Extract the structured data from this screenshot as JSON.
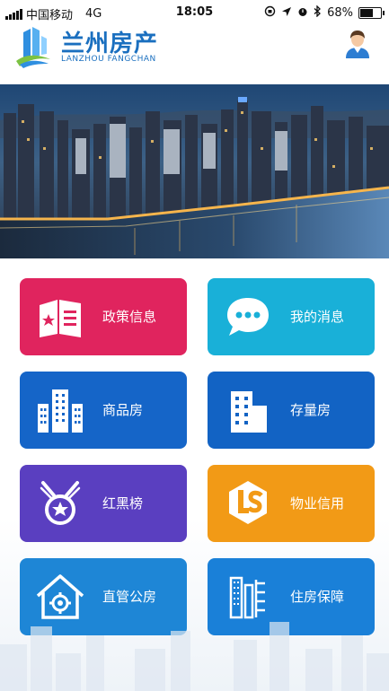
{
  "status_bar": {
    "carrier": "中国移动",
    "network": "4G",
    "time": "18:05",
    "battery": "68%",
    "battery_level": 0.68
  },
  "header": {
    "title": "兰州房产",
    "subtitle": "LANZHOU FANGCHAN",
    "avatar_icon": "user-avatar-icon"
  },
  "menu": [
    {
      "label": "政策信息",
      "color": "#e0245e",
      "icon": "policy-icon"
    },
    {
      "label": "我的消息",
      "color": "#19b0d8",
      "icon": "message-icon"
    },
    {
      "label": "商品房",
      "color": "#1565c8",
      "icon": "buildings-icon"
    },
    {
      "label": "存量房",
      "color": "#1263c4",
      "icon": "building-icon"
    },
    {
      "label": "红黑榜",
      "color": "#5a3fc0",
      "icon": "medal-icon"
    },
    {
      "label": "物业信用",
      "color": "#f29a16",
      "icon": "property-credit-icon"
    },
    {
      "label": "直管公房",
      "color": "#1e86d6",
      "icon": "public-house-icon"
    },
    {
      "label": "住房保障",
      "color": "#1a80d8",
      "icon": "housing-security-icon"
    }
  ]
}
